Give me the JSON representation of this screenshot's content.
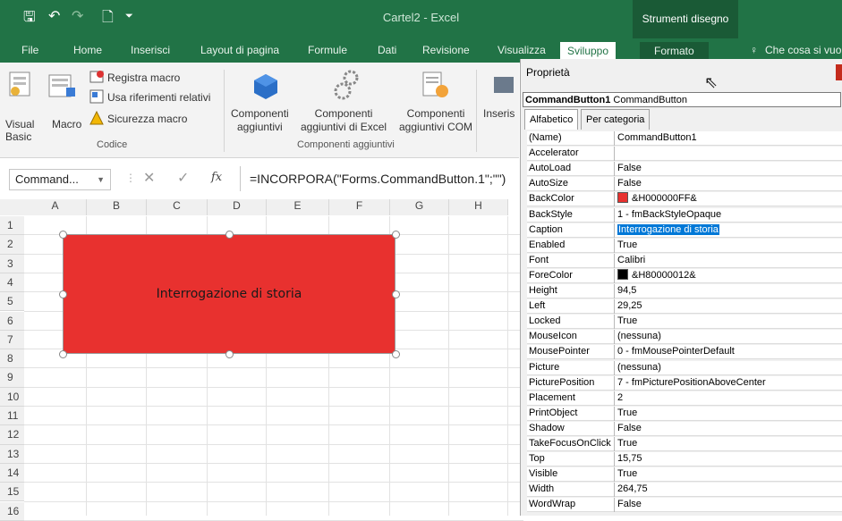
{
  "window": {
    "title": "Cartel2 - Excel",
    "context_tab": "Strumenti disegno"
  },
  "qat": {
    "save": "🖫",
    "undo": "↶",
    "redo": "↷",
    "new": "🗋",
    "more": "⏷"
  },
  "tabs": [
    "File",
    "Home",
    "Inserisci",
    "Layout di pagina",
    "Formule",
    "Dati",
    "Revisione",
    "Visualizza",
    "Sviluppo",
    "Formato",
    "Che cosa si vuo"
  ],
  "tell_me_icon": "lightbulb-icon",
  "ribbon": {
    "visual_basic": [
      "Visual",
      "Basic"
    ],
    "macro": "Macro",
    "record_macro": "Registra macro",
    "relative_refs": "Usa riferimenti relativi",
    "macro_security": "Sicurezza macro",
    "group_code": "Codice",
    "addins": [
      "Componenti",
      "aggiuntivi"
    ],
    "excel_addins": [
      "Componenti",
      "aggiuntivi di Excel"
    ],
    "com_addins": [
      "Componenti",
      "aggiuntivi COM"
    ],
    "group_addins": "Componenti aggiuntivi",
    "insert": "Inseris"
  },
  "formula_bar": {
    "name_box": "Command...",
    "formula": "=INCORPORA(\"Forms.CommandButton.1\";\"\")",
    "fx": "fx"
  },
  "columns": [
    "A",
    "B",
    "C",
    "D",
    "E",
    "F",
    "G",
    "H"
  ],
  "rows": [
    "1",
    "2",
    "3",
    "4",
    "5",
    "6",
    "7",
    "8",
    "9",
    "10",
    "11",
    "12",
    "13",
    "14",
    "15",
    "16"
  ],
  "button": {
    "caption": "Interrogazione di storia",
    "color": "#e8312f"
  },
  "properties": {
    "title": "Proprietà",
    "object_name": "CommandButton1",
    "object_type": "CommandButton",
    "tabs": [
      "Alfabetico",
      "Per categoria"
    ],
    "rows": [
      {
        "name": "(Name)",
        "value": "CommandButton1"
      },
      {
        "name": "Accelerator",
        "value": ""
      },
      {
        "name": "AutoLoad",
        "value": "False"
      },
      {
        "name": "AutoSize",
        "value": "False"
      },
      {
        "name": "BackColor",
        "value": "&H000000FF&",
        "swatch": "#e8312f"
      },
      {
        "name": "BackStyle",
        "value": "1 - fmBackStyleOpaque"
      },
      {
        "name": "Caption",
        "value": "Interrogazione di storia",
        "selected": true
      },
      {
        "name": "Enabled",
        "value": "True"
      },
      {
        "name": "Font",
        "value": "Calibri"
      },
      {
        "name": "ForeColor",
        "value": "&H80000012&",
        "swatch": "#000000"
      },
      {
        "name": "Height",
        "value": "94,5"
      },
      {
        "name": "Left",
        "value": "29,25"
      },
      {
        "name": "Locked",
        "value": "True"
      },
      {
        "name": "MouseIcon",
        "value": "(nessuna)"
      },
      {
        "name": "MousePointer",
        "value": "0 - fmMousePointerDefault"
      },
      {
        "name": "Picture",
        "value": "(nessuna)"
      },
      {
        "name": "PicturePosition",
        "value": "7 - fmPicturePositionAboveCenter"
      },
      {
        "name": "Placement",
        "value": "2"
      },
      {
        "name": "PrintObject",
        "value": "True"
      },
      {
        "name": "Shadow",
        "value": "False"
      },
      {
        "name": "TakeFocusOnClick",
        "value": "True"
      },
      {
        "name": "Top",
        "value": "15,75"
      },
      {
        "name": "Visible",
        "value": "True"
      },
      {
        "name": "Width",
        "value": "264,75"
      },
      {
        "name": "WordWrap",
        "value": "False"
      }
    ]
  }
}
